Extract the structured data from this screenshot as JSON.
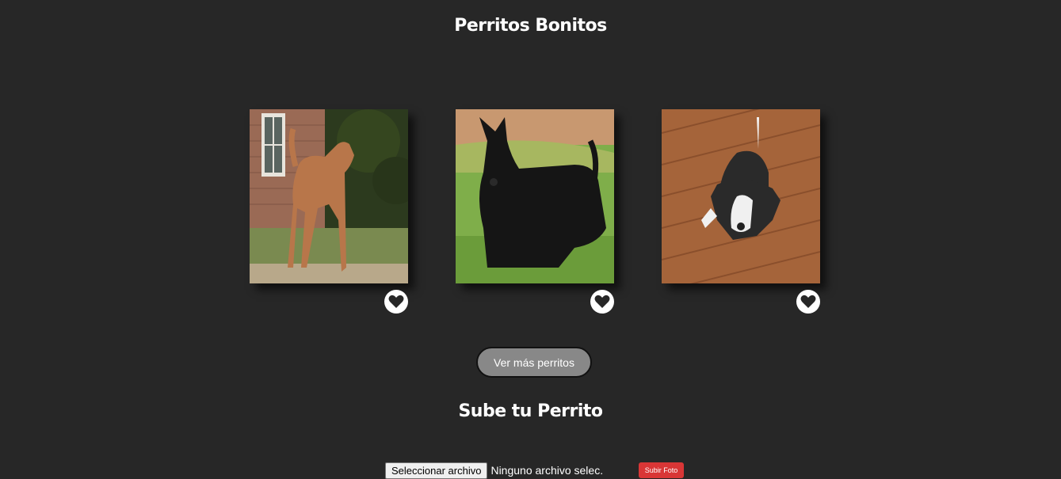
{
  "header": {
    "title": "Perritos Bonitos"
  },
  "gallery": {
    "dogs": [
      {
        "photo_icon": "airedale-terrier-photo",
        "like_icon": "heart-icon"
      },
      {
        "photo_icon": "scottish-terrier-photo",
        "like_icon": "heart-icon"
      },
      {
        "photo_icon": "pitbull-puppy-photo",
        "like_icon": "heart-icon"
      }
    ],
    "more_label": "Ver más perritos"
  },
  "upload": {
    "title": "Sube tu Perrito",
    "file_button_label": "Seleccionar archivo",
    "file_status": "Ninguno archivo selec.",
    "submit_label": "Subir Foto"
  },
  "colors": {
    "background": "#272727",
    "more_button": "#888888",
    "upload_button": "#d93636"
  }
}
